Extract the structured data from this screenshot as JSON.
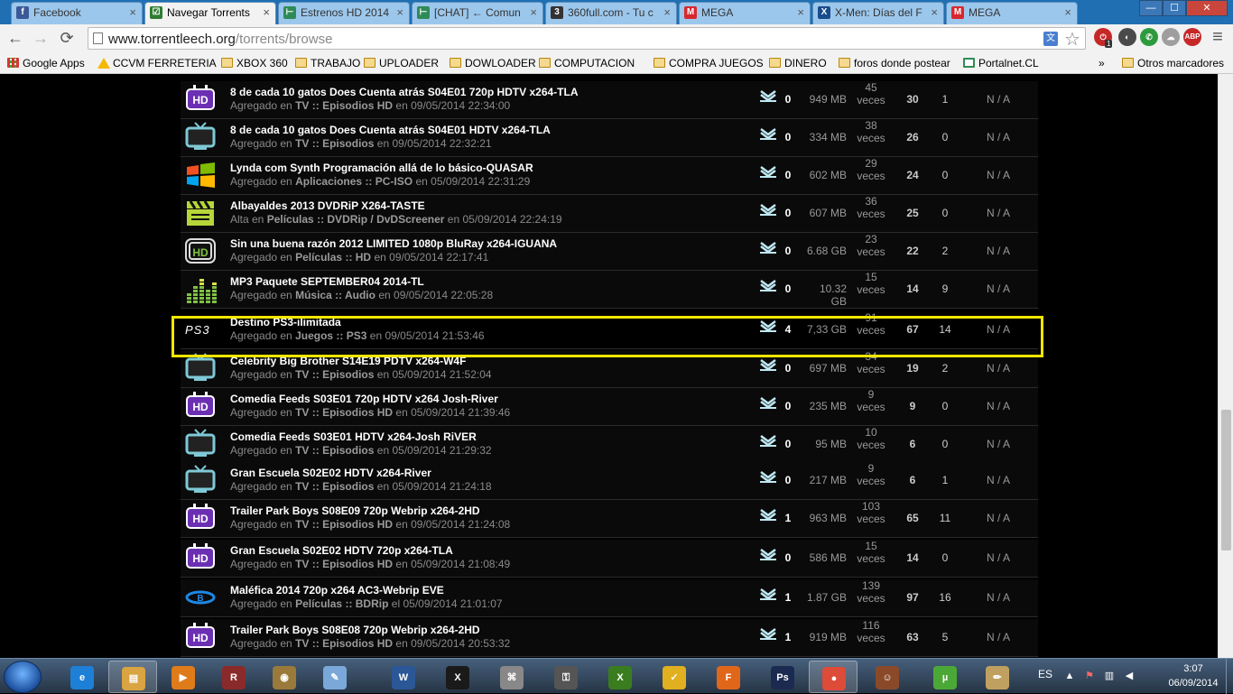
{
  "tabs": [
    {
      "title": "Facebook",
      "color": "#3b5998",
      "glyph": "f"
    },
    {
      "title": "Navegar Torrents",
      "color": "#2e7d32",
      "glyph": "☑"
    },
    {
      "title": "Estrenos HD 2014",
      "color": "#2e8b57",
      "glyph": "⊢"
    },
    {
      "title": "[CHAT] ← Comun",
      "color": "#2e8b57",
      "glyph": "⊢"
    },
    {
      "title": "360full.com - Tu c",
      "color": "#333333",
      "glyph": "3"
    },
    {
      "title": "MEGA",
      "color": "#d9272e",
      "glyph": "M"
    },
    {
      "title": "X-Men: Días del F",
      "color": "#1a4c8b",
      "glyph": "X"
    },
    {
      "title": "MEGA",
      "color": "#d9272e",
      "glyph": "M"
    }
  ],
  "window_controls": {
    "minimize": "—",
    "maximize": "☐",
    "close": "✕"
  },
  "toolbar": {
    "back": "←",
    "forward": "→",
    "reload": "⟳",
    "url_host": "www.torrentleech.org",
    "url_path": "/torrents/browse",
    "star": "☆",
    "menu": "≡",
    "ext_badge": "1",
    "abp": "ABP"
  },
  "bookmarks": [
    {
      "label": "Google Apps",
      "icon": "apps-grid-icon"
    },
    {
      "label": "CCVM FERRETERIA",
      "icon": "warning-triangle-icon"
    },
    {
      "label": "XBOX 360",
      "icon": "folder-icon"
    },
    {
      "label": "TRABAJO",
      "icon": "folder-icon"
    },
    {
      "label": "UPLOADER",
      "icon": "folder-icon"
    },
    {
      "label": "DOWLOADER",
      "icon": "folder-icon"
    },
    {
      "label": "COMPUTACION",
      "icon": "folder-icon"
    },
    {
      "label": "COMPRA JUEGOS",
      "icon": "folder-icon"
    },
    {
      "label": "DINERO",
      "icon": "folder-icon"
    },
    {
      "label": "foros donde postear",
      "icon": "folder-icon"
    },
    {
      "label": "Portalnet.CL",
      "icon": "portalnet-icon"
    },
    {
      "label": "»",
      "icon": "chevron-more-icon"
    },
    {
      "label": "Otros marcadores",
      "icon": "folder-icon"
    }
  ],
  "torrents": [
    {
      "icon": "hd-purple",
      "title": "8 de cada 10 gatos Does Cuenta atrás S04E01 720p HDTV x264-TLA",
      "prefix": "Agregado en",
      "category": "TV :: Episodios HD",
      "date_prefix": "en",
      "date": "09/05/2014 22:34:00",
      "comments": "0",
      "size": "949 MB",
      "snatched": "45",
      "snatched_unit": "veces",
      "seeders": "30",
      "leechers": "1",
      "ratio": "N / A"
    },
    {
      "icon": "tv",
      "title": "8 de cada 10 gatos Does Cuenta atrás S04E01 HDTV x264-TLA",
      "prefix": "Agregado en",
      "category": "TV :: Episodios",
      "date_prefix": "en",
      "date": "09/05/2014 22:32:21",
      "comments": "0",
      "size": "334 MB",
      "snatched": "38",
      "snatched_unit": "veces",
      "seeders": "26",
      "leechers": "0",
      "ratio": "N / A"
    },
    {
      "icon": "windows",
      "title": "Lynda com Synth Programación allá de lo básico-QUASAR",
      "prefix": "Agregado en",
      "category": "Aplicaciones :: PC-ISO",
      "date_prefix": "en",
      "date": "05/09/2014 22:31:29",
      "comments": "0",
      "size": "602 MB",
      "snatched": "29",
      "snatched_unit": "veces",
      "seeders": "24",
      "leechers": "0",
      "ratio": "N / A"
    },
    {
      "icon": "clapper",
      "title": "Albayaldes 2013 DVDRiP X264-TASTE",
      "prefix": "Alta en",
      "category": "Películas :: DVDRip / DvDScreener",
      "date_prefix": "en",
      "date": "05/09/2014 22:24:19",
      "comments": "0",
      "size": "607 MB",
      "snatched": "36",
      "snatched_unit": "veces",
      "seeders": "25",
      "leechers": "0",
      "ratio": "N / A"
    },
    {
      "icon": "hd-outline",
      "title": "Sin una buena razón 2012 LIMITED 1080p BluRay x264-IGUANA",
      "prefix": "Agregado en",
      "category": "Películas :: HD",
      "date_prefix": "en",
      "date": "09/05/2014 22:17:41",
      "comments": "0",
      "size": "6.68 GB",
      "snatched": "23",
      "snatched_unit": "veces",
      "seeders": "22",
      "leechers": "2",
      "ratio": "N / A"
    },
    {
      "icon": "equalizer",
      "title": "MP3 Paquete SEPTEMBER04 2014-TL",
      "prefix": "Agregado en",
      "category": "Música :: Audio",
      "date_prefix": "en",
      "date": "09/05/2014 22:05:28",
      "comments": "0",
      "size": "10.32 GB",
      "snatched": "15",
      "snatched_unit": "veces",
      "seeders": "14",
      "leechers": "9",
      "ratio": "N / A"
    },
    {
      "icon": "ps3",
      "title": "Destino PS3-ilimitada",
      "prefix": "Agregado en",
      "category": "Juegos :: PS3",
      "date_prefix": "en",
      "date": "09/05/2014 21:53:46",
      "comments": "4",
      "size": "7,33 GB",
      "snatched": "91",
      "snatched_unit": "veces",
      "seeders": "67",
      "leechers": "14",
      "ratio": "N / A",
      "highlight": true
    },
    {
      "icon": "tv",
      "title": "Celebrity Big Brother S14E19 PDTV x264-W4F",
      "prefix": "Agregado en",
      "category": "TV :: Episodios",
      "date_prefix": "en",
      "date": "05/09/2014 21:52:04",
      "comments": "0",
      "size": "697 MB",
      "snatched": "34",
      "snatched_unit": "veces",
      "seeders": "19",
      "leechers": "2",
      "ratio": "N / A"
    },
    {
      "icon": "hd-purple",
      "title": "Comedia Feeds S03E01 720p HDTV x264 Josh-River",
      "prefix": "Agregado en",
      "category": "TV :: Episodios HD",
      "date_prefix": "en",
      "date": "05/09/2014 21:39:46",
      "comments": "0",
      "size": "235 MB",
      "snatched": "9",
      "snatched_unit": "veces",
      "seeders": "9",
      "leechers": "0",
      "ratio": "N / A"
    },
    {
      "icon": "tv",
      "title": "Comedia Feeds S03E01 HDTV x264-Josh RiVER",
      "prefix": "Agregado en",
      "category": "TV :: Episodios",
      "date_prefix": "en",
      "date": "05/09/2014 21:29:32",
      "comments": "0",
      "size": "95 MB",
      "snatched": "10",
      "snatched_unit": "veces",
      "seeders": "6",
      "leechers": "0",
      "ratio": "N / A"
    },
    {
      "icon": "tv",
      "title": "Gran Escuela S02E02 HDTV x264-River",
      "prefix": "Agregado en",
      "category": "TV :: Episodios",
      "date_prefix": "en",
      "date": "05/09/2014 21:24:18",
      "comments": "0",
      "size": "217 MB",
      "snatched": "9",
      "snatched_unit": "veces",
      "seeders": "6",
      "leechers": "1",
      "ratio": "N / A"
    },
    {
      "icon": "hd-purple",
      "title": "Trailer Park Boys S08E09 720p Webrip x264-2HD",
      "prefix": "Agregado en",
      "category": "TV :: Episodios HD",
      "date_prefix": "en",
      "date": "09/05/2014 21:24:08",
      "comments": "1",
      "size": "963 MB",
      "snatched": "103",
      "snatched_unit": "veces",
      "seeders": "65",
      "leechers": "11",
      "ratio": "N / A"
    },
    {
      "icon": "hd-purple",
      "title": "Gran Escuela S02E02 HDTV 720p x264-TLA",
      "prefix": "Agregado en",
      "category": "TV :: Episodios HD",
      "date_prefix": "en",
      "date": "05/09/2014 21:08:49",
      "comments": "0",
      "size": "586 MB",
      "snatched": "15",
      "snatched_unit": "veces",
      "seeders": "14",
      "leechers": "0",
      "ratio": "N / A"
    },
    {
      "icon": "bluray",
      "title": "Maléfica 2014 720p x264 AC3-Webrip EVE",
      "prefix": "Agregado en",
      "category": "Películas :: BDRip",
      "date_prefix": "el",
      "date": "05/09/2014 21:01:07",
      "comments": "1",
      "size": "1.87 GB",
      "snatched": "139",
      "snatched_unit": "veces",
      "seeders": "97",
      "leechers": "16",
      "ratio": "N / A"
    },
    {
      "icon": "hd-purple",
      "title": "Trailer Park Boys S08E08 720p Webrip x264-2HD",
      "prefix": "Agregado en",
      "category": "TV :: Episodios HD",
      "date_prefix": "en",
      "date": "09/05/2014 20:53:32",
      "comments": "1",
      "size": "919 MB",
      "snatched": "116",
      "snatched_unit": "veces",
      "seeders": "63",
      "leechers": "5",
      "ratio": "N / A"
    }
  ],
  "taskbar": {
    "apps": [
      {
        "name": "ie",
        "glyph": "e",
        "color": "#1e7fd6"
      },
      {
        "name": "explorer",
        "glyph": "▤",
        "color": "#d9a441"
      },
      {
        "name": "media-player",
        "glyph": "▶",
        "color": "#e07b1a"
      },
      {
        "name": "winrar",
        "glyph": "R",
        "color": "#8b2a2a"
      },
      {
        "name": "dvd",
        "glyph": "◉",
        "color": "#9a7a3a"
      },
      {
        "name": "notes",
        "glyph": "✎",
        "color": "#7aa8d8"
      },
      {
        "name": "word",
        "glyph": "W",
        "color": "#2b5797"
      },
      {
        "name": "xbox-tool",
        "glyph": "X",
        "color": "#1a1a1a"
      },
      {
        "name": "network",
        "glyph": "⌘",
        "color": "#888888"
      },
      {
        "name": "usb",
        "glyph": "⚿",
        "color": "#555555"
      },
      {
        "name": "xbox",
        "glyph": "X",
        "color": "#3a7d1e"
      },
      {
        "name": "norton",
        "glyph": "✓",
        "color": "#e0b020"
      },
      {
        "name": "firefox",
        "glyph": "F",
        "color": "#e0661a"
      },
      {
        "name": "photoshop",
        "glyph": "Ps",
        "color": "#1a2a50"
      },
      {
        "name": "chrome",
        "glyph": "●",
        "color": "#dd4b39"
      },
      {
        "name": "doom",
        "glyph": "☺",
        "color": "#8a4a2a"
      },
      {
        "name": "utorrent",
        "glyph": "µ",
        "color": "#4ca836"
      },
      {
        "name": "paint",
        "glyph": "✏",
        "color": "#c0a060"
      }
    ],
    "language": "ES",
    "time": "3:07",
    "date": "06/09/2014"
  }
}
